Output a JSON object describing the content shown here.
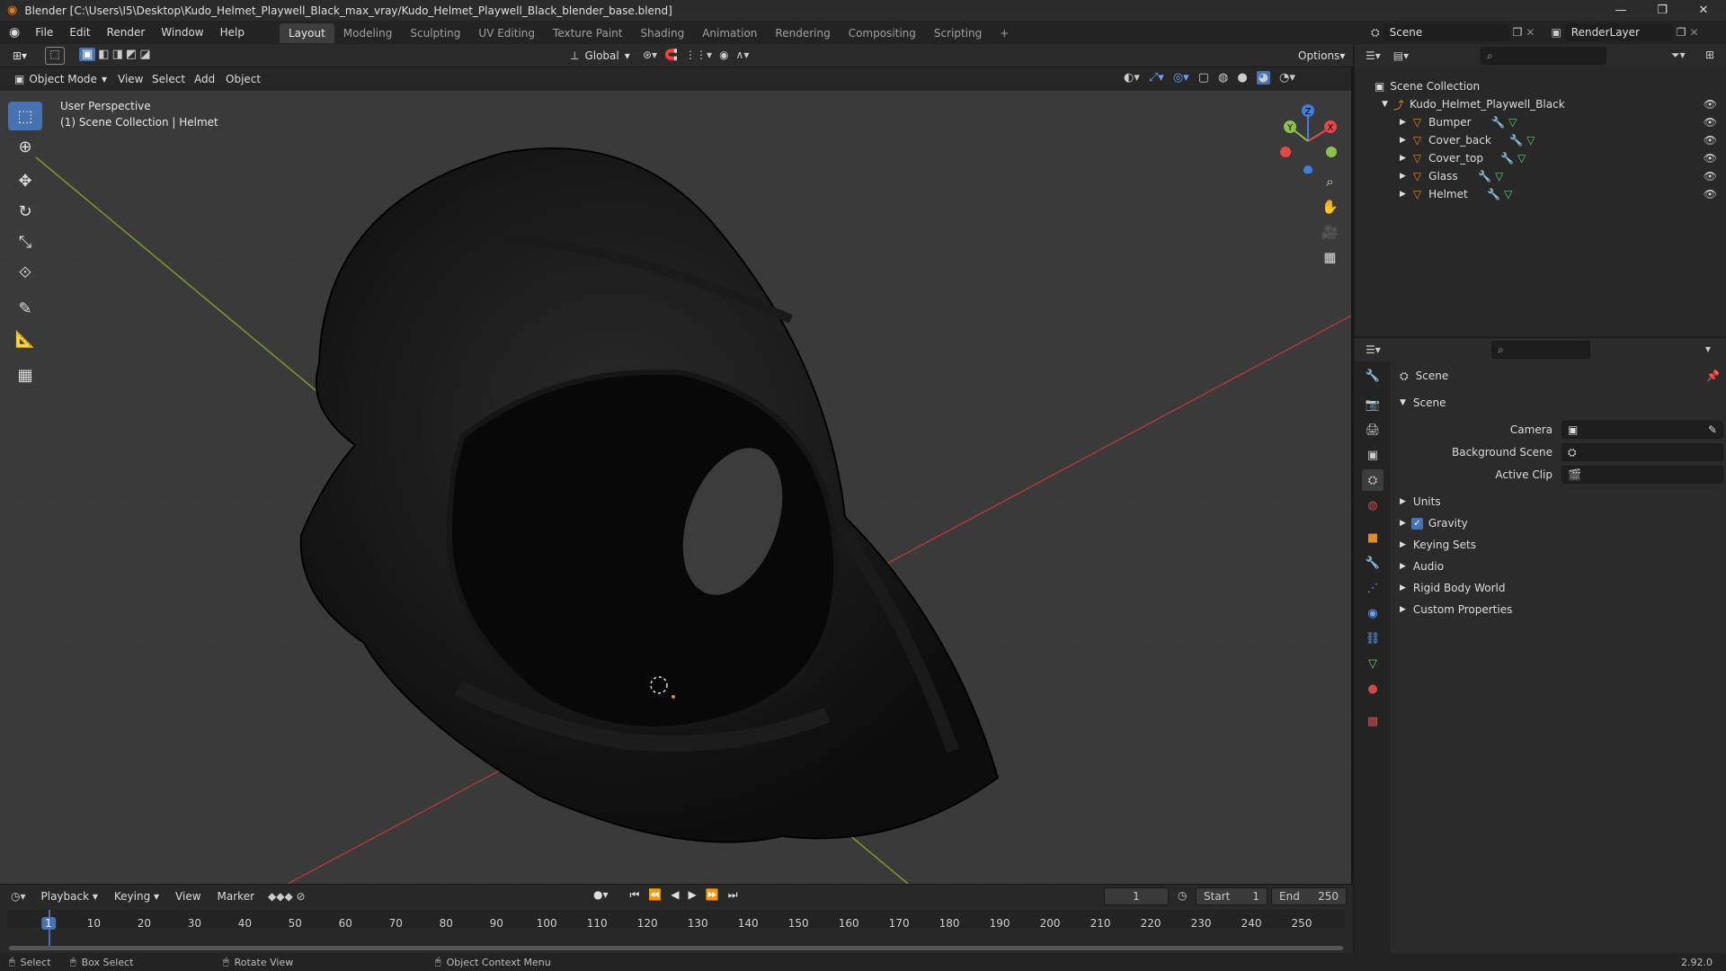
{
  "titlebar": {
    "title": "Blender [C:\\Users\\I5\\Desktop\\Kudo_Helmet_Playwell_Black_max_vray/Kudo_Helmet_Playwell_Black_blender_base.blend]"
  },
  "menu": [
    "File",
    "Edit",
    "Render",
    "Window",
    "Help"
  ],
  "workspaces": [
    "Layout",
    "Modeling",
    "Sculpting",
    "UV Editing",
    "Texture Paint",
    "Shading",
    "Animation",
    "Rendering",
    "Compositing",
    "Scripting",
    "+"
  ],
  "scene_field": "Scene",
  "renderlayer_field": "RenderLayer",
  "toolheader": {
    "orientation": "Global",
    "options": "Options"
  },
  "vpheader": {
    "mode": "Object Mode",
    "menus": [
      "View",
      "Select",
      "Add",
      "Object"
    ]
  },
  "viewport": {
    "perspective": "User Perspective",
    "collection_info": "(1) Scene Collection | Helmet",
    "gizmo": {
      "x": "X",
      "y": "Y",
      "z": "Z"
    }
  },
  "outliner": {
    "root": "Scene Collection",
    "collection": "Kudo_Helmet_Playwell_Black",
    "objects": [
      "Bumper",
      "Cover_back",
      "Cover_top",
      "Glass",
      "Helmet"
    ]
  },
  "properties": {
    "context": "Scene",
    "panel": "Scene",
    "fields": [
      {
        "label": "Camera"
      },
      {
        "label": "Background Scene"
      },
      {
        "label": "Active Clip"
      }
    ],
    "sections": [
      "Units",
      "Gravity",
      "Keying Sets",
      "Audio",
      "Rigid Body World",
      "Custom Properties"
    ],
    "gravity_checked": true
  },
  "timeline": {
    "menus": [
      "Playback",
      "Keying",
      "View",
      "Marker"
    ],
    "current_frame": "1",
    "start_label": "Start",
    "start": "1",
    "end_label": "End",
    "end": "250",
    "ticks": [
      "1",
      "10",
      "20",
      "30",
      "40",
      "50",
      "60",
      "70",
      "80",
      "90",
      "100",
      "110",
      "120",
      "130",
      "140",
      "150",
      "160",
      "170",
      "180",
      "190",
      "200",
      "210",
      "220",
      "230",
      "240",
      "250"
    ]
  },
  "status": {
    "select": "Select",
    "box_select": "Box Select",
    "rotate": "Rotate View",
    "context_menu": "Object Context Menu",
    "version": "2.92.0"
  },
  "colors": {
    "accent": "#4772b3",
    "x_axis": "#e8474a",
    "y_axis": "#8bc34a",
    "z_axis": "#3f7fe0",
    "object_orange": "#e08a2c"
  }
}
